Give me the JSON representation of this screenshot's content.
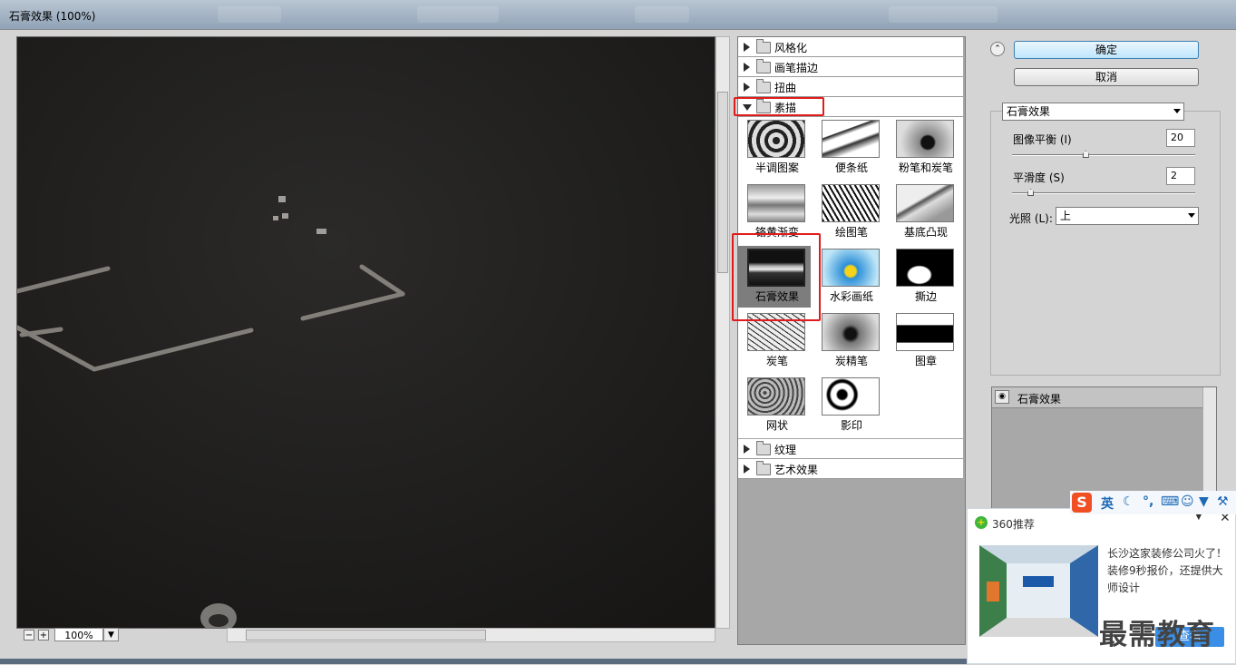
{
  "window": {
    "title": "石膏效果 (100%)"
  },
  "preview": {
    "zoom": "100%",
    "minus": "−",
    "plus": "+"
  },
  "gallery": {
    "categories_top": [
      "风格化",
      "画笔描边",
      "扭曲"
    ],
    "open_category": "素描",
    "filters": [
      "半调图案",
      "便条纸",
      "粉笔和炭笔",
      "铬黄渐变",
      "绘图笔",
      "基底凸现",
      "石膏效果",
      "水彩画纸",
      "撕边",
      "炭笔",
      "炭精笔",
      "图章",
      "网状",
      "影印"
    ],
    "selected_filter": "石膏效果",
    "categories_bottom": [
      "纹理",
      "艺术效果"
    ]
  },
  "buttons": {
    "ok": "确定",
    "cancel": "取消",
    "collapse": "⌃"
  },
  "settings": {
    "filter_select": "石膏效果",
    "image_balance": {
      "label": "图像平衡 (I)",
      "value": "20",
      "level": 0.4
    },
    "smoothness": {
      "label": "平滑度 (S)",
      "value": "2",
      "level": 0.1
    },
    "light": {
      "label": "光照 (L):",
      "value": "上"
    }
  },
  "layers": {
    "item": "石膏效果"
  },
  "ime": {
    "lang": "英",
    "icons": [
      "s-logo-icon",
      "moon-icon",
      "punctuation-icon",
      "keyboard-icon",
      "user-icon",
      "shirt-icon",
      "wrench-icon"
    ]
  },
  "popup": {
    "title": "360推荐",
    "text": "长沙这家装修公司火了！装修9秒报价，还提供大师设计",
    "button": "查看",
    "watermark": "最需教育"
  },
  "colors": {
    "accent_red": "#e11b1b",
    "popup_blue": "#3a8ee6"
  }
}
